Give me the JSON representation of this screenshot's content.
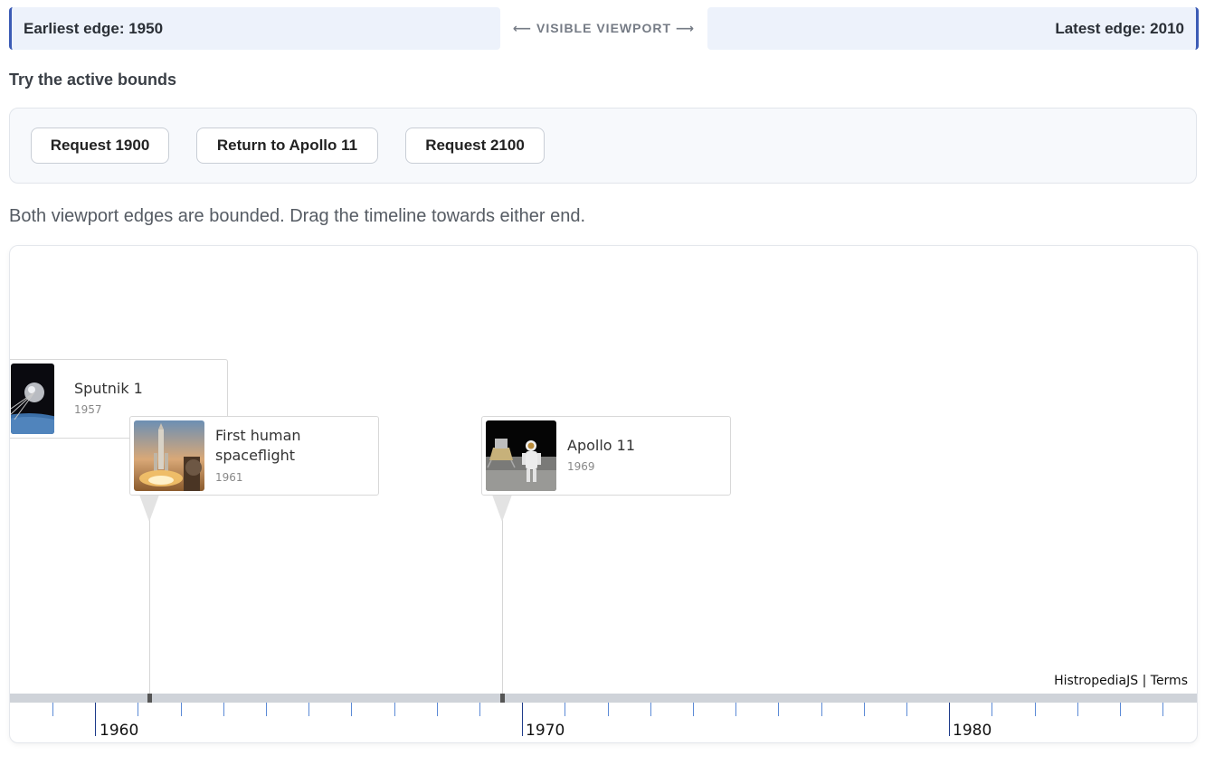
{
  "viewport": {
    "earliest_label": "Earliest edge: 1950",
    "center_label": "⟵ VISIBLE VIEWPORT ⟶",
    "latest_label": "Latest edge: 2010"
  },
  "controls": {
    "title": "Try the active bounds",
    "buttons": [
      "Request 1900",
      "Return to Apollo 11",
      "Request 2100"
    ]
  },
  "status": "Both viewport edges are bounded. Drag the timeline towards either end.",
  "timeline": {
    "events": [
      {
        "title": "Sputnik 1",
        "year": "1957"
      },
      {
        "title": "First human spaceflight",
        "year": "1961"
      },
      {
        "title": "Apollo 11",
        "year": "1969"
      }
    ],
    "axis_labels": [
      "1960",
      "1970",
      "1980"
    ],
    "credit": "HistropediaJS | Terms"
  }
}
